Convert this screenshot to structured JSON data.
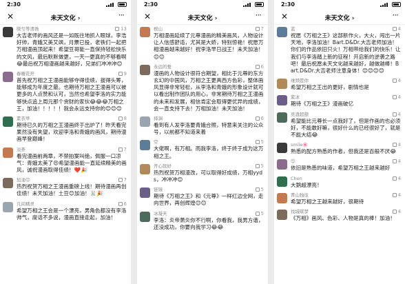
{
  "phones": [
    {
      "status_time": "2:30",
      "nav_title": "未天文化",
      "comments": [
        {
          "name": "晓兮等清扬",
          "likes": "13",
          "text": "大吉老师的画风还是一如既往地抓人眼球，李浩好帅，青娥又美又飒，月票已投，老铁们一起把万相漫画顶起来！希望豆哥能一直保持轻松快乐的文风，最后默默做更，一天一更真的不够看啊😂最后祝万相漫画越来越好，兄弟们冲冲冲😊"
        },
        {
          "name": "春暖花开",
          "likes": "9",
          "text": "首先祝万相之王漫画能够夺得佳绩，拔得头筹，能够成为年度之最。也期待万相之王漫画可以被更多的人点赞和认可，当然也希望李洛的实力能够快点追上周元那个贪财的家伙😂😂😂万相之王，加油！！！！！我会永远支持你的😊😊😊"
        },
        {
          "name": "素衣苹",
          "likes": "8",
          "text": "期待已久的万相之王漫画终于出炉了！昨天看完果然没有失望，欢迎李洛和青娥的画风，期待漫画早登巅峰！"
        },
        {
          "name": "淡荼",
          "likes": "7",
          "text": "看完漫画前两章，不禁拍案叫绝，佩服一口凉气：青娥太美了😍希望漫画能一直延续精美的画风，诚祝漫画取得佳绩！❤️🎉"
        },
        {
          "name": "加油😊",
          "likes": "7",
          "text": "热烈祝贺万相之王漫画重磅上线！期待漫画再创佳绩！未天加油！土豆😊加油！🐰🎉"
        },
        {
          "name": "凡间精灵",
          "likes": "6",
          "text": "希望万相之王会是一个漂亮，男角色都没有李洛帅气，度话不多说，漫画直接走起，加油！"
        }
      ]
    },
    {
      "status_time": "2:30",
      "nav_title": "未天文化",
      "comments": [
        {
          "name": "根山",
          "likes": "7",
          "text": "万相漫画延续了元尊漫画的精美画风，人物设计让人信感舒适，尤其是大娇，特别惊艳！祝愿万相漫画越来越好！祝李洛早日战王！未天加油！😊😊"
        },
        {
          "name": "永远的誓",
          "likes": "6",
          "text": "漫画的人物设计很符合期望，相比于元尊的东方玄幻的中国风，万相之王更具西方色彩，整体画风显得非常轻松，从李洛和青娥的形象设计就可以看出制作团队的用心，非常期待万相之王漫画的未来和发展，相信肯定会取得更优异的成绩，会一直支持下去！万相加油！未天加油！"
        },
        {
          "name": "择渊",
          "likes": "6",
          "text": "看到有人发李洛要青娥合照，特意来关注的公众号，以前都不知道来着"
        },
        {
          "name": "空",
          "likes": "5",
          "text": "大佬啊，有万相。而我李洛，终于终于成为这万相之王。"
        },
        {
          "name": "开心就好",
          "likes": "5",
          "text": "热烈祝贺万相漫改，可以取得好成绩，万相yyds，冲冲冲😊"
        },
        {
          "name": "链镜",
          "likes": "5",
          "text": "期待《万相之王》和《元尊》一样红边全网，走向世界，再创辉煌😊😊"
        },
        {
          "name": "冰凝天",
          "likes": "5",
          "text": "李洛：炎帝萧炎你不行啊，你看我，我男方谐，还没成功，你要向我学习😂😂"
        }
      ]
    },
    {
      "status_time": "2:30",
      "nav_title": "未天文化",
      "comments": [
        {
          "name": "蓝",
          "likes": "4",
          "text": "祝愿《万相之王》这部新作火，大火，闯出一片天地，李洛加油！Bart.D&Dr.大吉老师加油！你们的作品依旧只火！万相带给我们的快乐！让我们与李洛踏上新的征程！开启新的逆袭之路吧！最后祝愿未天文化越来越好，越做越棒！Bart.D&Dr.大吉老师注意身体！😊😊😊😊"
        },
        {
          "name": "维频是你",
          "likes": "4",
          "text": "希望万相之王出的更好，剧情也是"
        },
        {
          "name": "紫冰",
          "likes": "4",
          "text": "期待《万相之王》漫画破亿"
        },
        {
          "name": "竞渡超额",
          "likes": "4",
          "text": "希望能比元尊长一点我好了，但是作画的也必须好，不能敢好嘛，很好什么的已经很好了，就是不能大结😂"
        },
        {
          "name": "smile🌸",
          "likes": "4",
          "text": "熟悉的配方熟悉的作者，但我还是百般不厌😂"
        },
        {
          "name": "😊",
          "likes": "4",
          "text": "依旧是熟悉的味道，希望万相之王越来越好"
        },
        {
          "name": "Chen",
          "likes": "4",
          "text": "大鹅超漂亮！"
        },
        {
          "name": "青山独往",
          "likes": "4",
          "text": "希望万相之王越来越好，很期待"
        },
        {
          "name": "找城碳梦",
          "likes": "4",
          "text": "《万相》画风、色彩、人物是真的棒！加油！"
        }
      ]
    }
  ],
  "avatar_colors": [
    "#3a3a3a",
    "#8b6b8e",
    "#2f6e4e",
    "#c47a50",
    "#7c6a5b",
    "#9aa5b1",
    "#5b7d9b",
    "#b08a5a",
    "#6b5f8a",
    "#4c6b5a"
  ]
}
